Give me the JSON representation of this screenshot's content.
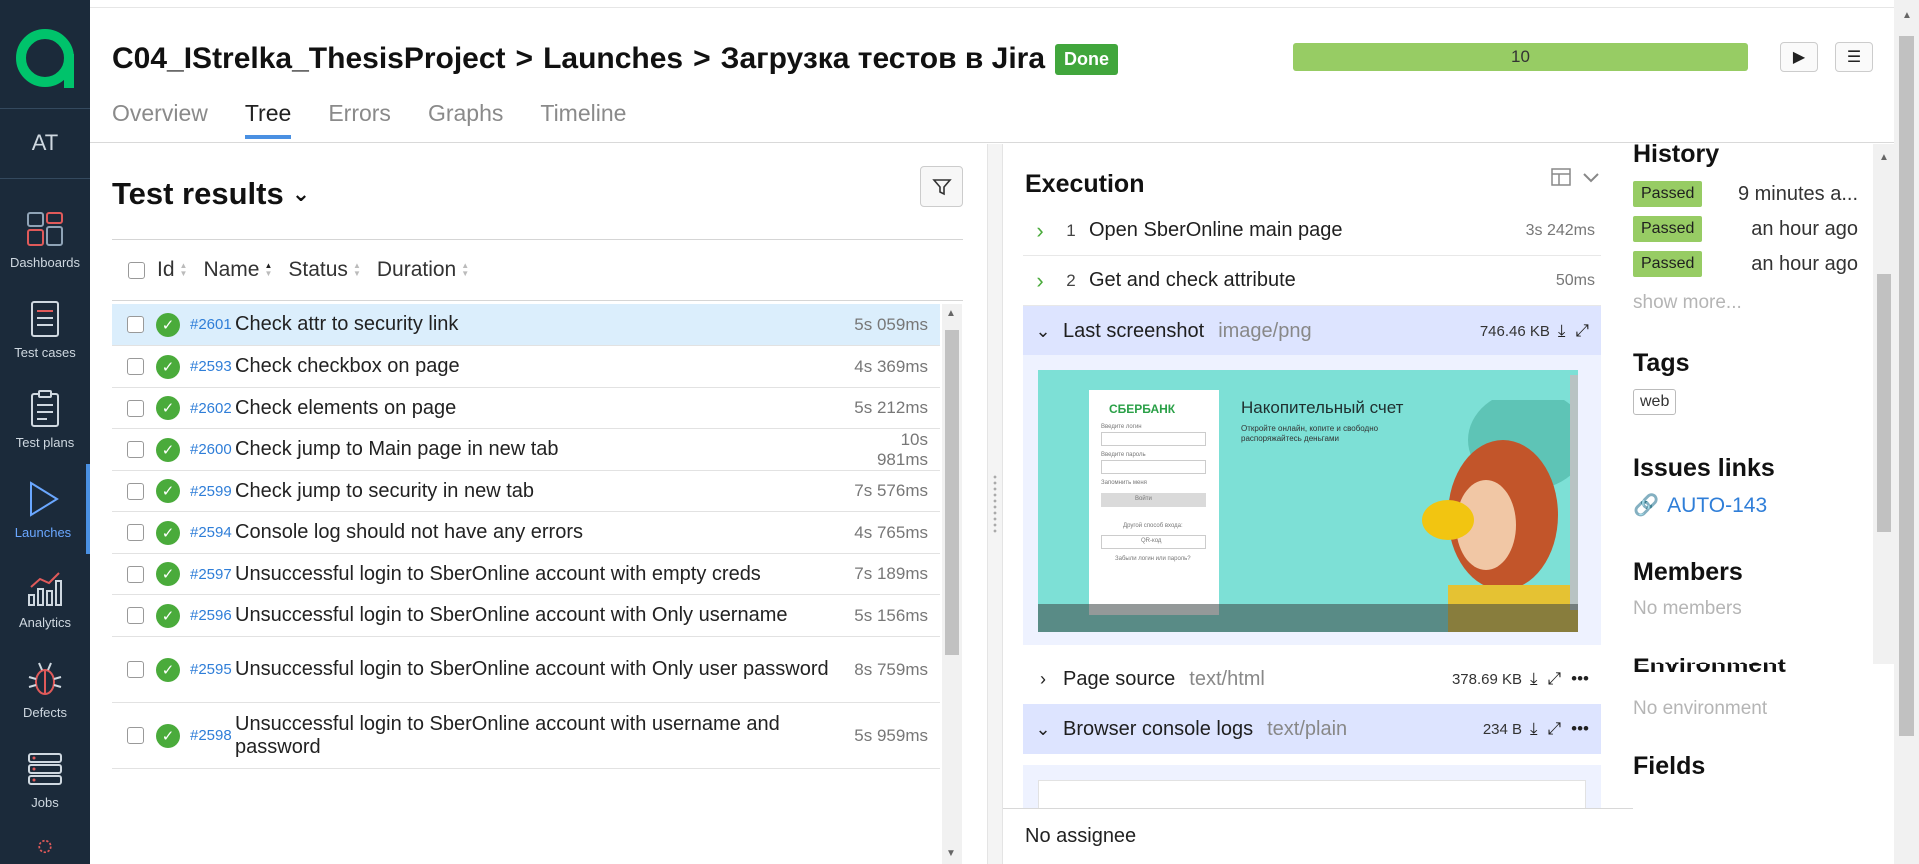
{
  "sidebar": {
    "logo": "a",
    "user_initials": "AT",
    "items": [
      {
        "label": "Dashboards",
        "icon": "dashboards-icon"
      },
      {
        "label": "Test cases",
        "icon": "test-cases-icon"
      },
      {
        "label": "Test plans",
        "icon": "test-plans-icon"
      },
      {
        "label": "Launches",
        "icon": "launches-icon",
        "active": true
      },
      {
        "label": "Analytics",
        "icon": "analytics-icon"
      },
      {
        "label": "Defects",
        "icon": "bug-icon"
      },
      {
        "label": "Jobs",
        "icon": "jobs-icon"
      }
    ]
  },
  "header": {
    "project": "C04_IStrelka_ThesisProject",
    "separator": ">",
    "section": "Launches",
    "launch": "Загрузка тестов в Jira",
    "status": "Done",
    "progress_count": "10",
    "tabs": [
      "Overview",
      "Tree",
      "Errors",
      "Graphs",
      "Timeline"
    ],
    "active_tab": "Tree",
    "run_button": "▶",
    "menu_button": "☰"
  },
  "test_results": {
    "title": "Test results",
    "columns": {
      "id": "Id",
      "name": "Name",
      "status": "Status",
      "duration": "Duration"
    },
    "rows": [
      {
        "id": "#2601",
        "name": "Check attr to security link",
        "duration": "5s 059ms",
        "selected": true
      },
      {
        "id": "#2593",
        "name": "Check checkbox on page",
        "duration": "4s 369ms"
      },
      {
        "id": "#2602",
        "name": "Check elements on page",
        "duration": "5s 212ms"
      },
      {
        "id": "#2600",
        "name": "Check jump to Main page in new tab",
        "duration": "10s 981ms"
      },
      {
        "id": "#2599",
        "name": "Check jump to security in new tab",
        "duration": "7s 576ms"
      },
      {
        "id": "#2594",
        "name": "Console log should not have any errors",
        "duration": "4s 765ms"
      },
      {
        "id": "#2597",
        "name": "Unsuccessful login to SberOnline account with empty creds",
        "duration": "7s 189ms"
      },
      {
        "id": "#2596",
        "name": "Unsuccessful login to SberOnline account with Only username",
        "duration": "5s 156ms"
      },
      {
        "id": "#2595",
        "name": "Unsuccessful login to SberOnline account with Only user password",
        "duration": "8s 759ms"
      },
      {
        "id": "#2598",
        "name": "Unsuccessful login to SberOnline account with username and password",
        "duration": "5s 959ms"
      }
    ]
  },
  "execution": {
    "title": "Execution",
    "steps": [
      {
        "num": "1",
        "title": "Open SberOnline main page",
        "duration": "3s 242ms"
      },
      {
        "num": "2",
        "title": "Get and check attribute",
        "duration": "50ms"
      }
    ],
    "attachments": [
      {
        "title": "Last screenshot",
        "mime": "image/png",
        "size": "746.46 KB",
        "open": true
      },
      {
        "title": "Page source",
        "mime": "text/html",
        "size": "378.69 KB",
        "open": false
      },
      {
        "title": "Browser console logs",
        "mime": "text/plain",
        "size": "234 B",
        "open": true
      }
    ],
    "screenshot": {
      "brand": "СБЕРБАНК",
      "heading": "Накопительный счет",
      "subtext": "Откройте онлайн, копите и свободно распоряжайтесь деньгами",
      "login_label": "Введите логин",
      "password_label": "Введите пароль",
      "remember": "Запомнить меня",
      "login_button": "Войти",
      "other_method": "Другой способ входа:",
      "qr": "QR-код",
      "forgot": "Забыли логин или пароль?"
    },
    "assignee": "No assignee"
  },
  "info": {
    "history_title": "History",
    "history": [
      {
        "status": "Passed",
        "when": "9 minutes a..."
      },
      {
        "status": "Passed",
        "when": "an hour ago"
      },
      {
        "status": "Passed",
        "when": "an hour ago"
      }
    ],
    "show_more": "show more...",
    "tags_title": "Tags",
    "tags": [
      "web"
    ],
    "issues_title": "Issues links",
    "issue": "AUTO-143",
    "members_title": "Members",
    "members_empty": "No members",
    "environment_title": "Environment",
    "environment_empty": "No environment",
    "fields_title": "Fields"
  },
  "colors": {
    "sidebar_bg": "#1b2a3a",
    "logo": "#00c36b",
    "accent": "#4a90e2",
    "passed": "#97cc64",
    "done": "#41a63c"
  }
}
